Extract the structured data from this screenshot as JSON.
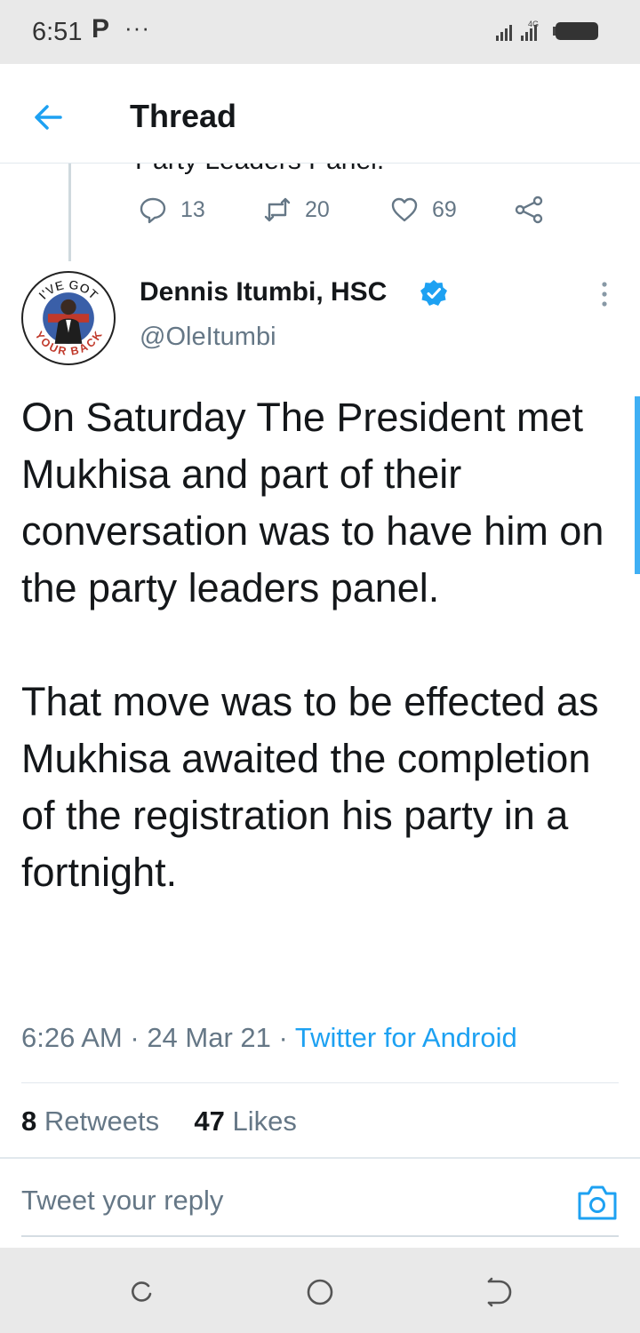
{
  "status_bar": {
    "time": "6:51",
    "app_indicator": "P",
    "overflow": "···",
    "network": "4G"
  },
  "header": {
    "title": "Thread",
    "back_icon": "arrow-left-icon"
  },
  "previous_tweet": {
    "clipped_text": "Party Leaders Panel.",
    "replies": "13",
    "retweets": "20",
    "likes": "69"
  },
  "tweet": {
    "author_name": "Dennis Itumbi, HSC",
    "handle": "@OleItumbi",
    "verified": true,
    "avatar_text_top": "I'VE GOT",
    "avatar_text_bottom": "YOUR BACK",
    "paragraphs": [
      "On Saturday The President met Mukhisa and part of their conversation was to have him on the party leaders panel.",
      "That move was to be effected as Mukhisa awaited the completion of the registration his party in a fortnight."
    ],
    "time": "6:26 AM",
    "date": "24 Mar 21",
    "source": "Twitter for Android",
    "retweets_count": "8",
    "retweets_label": "Retweets",
    "likes_count": "47",
    "likes_label": "Likes"
  },
  "reply": {
    "placeholder": "Tweet your reply"
  },
  "colors": {
    "accent": "#1da1f2",
    "text_primary": "#14171a",
    "text_secondary": "#657786",
    "divider": "#e1e8ed",
    "system_bar": "#e9e9e9"
  }
}
